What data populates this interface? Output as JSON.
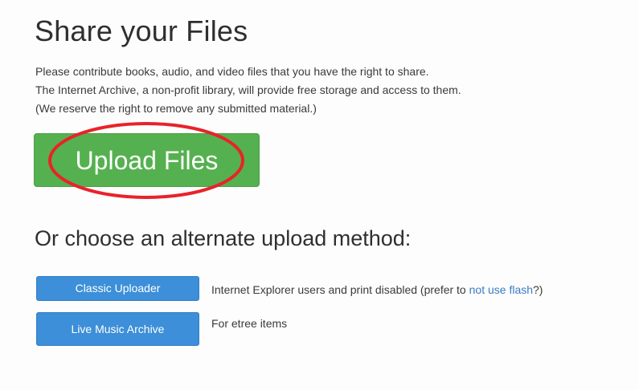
{
  "page": {
    "title": "Share your Files",
    "intro": [
      "Please contribute books, audio, and video files that you have the right to share.",
      "The Internet Archive, a non-profit library, will provide free storage and access to them.",
      "(We reserve the right to remove any submitted material.)"
    ],
    "upload_label": "Upload Files",
    "alternate_heading": "Or choose an alternate upload method:"
  },
  "alternate_methods": {
    "classic": {
      "label": "Classic Uploader",
      "desc_before": "Internet Explorer users and print disabled (prefer to ",
      "link_text": "not use flash",
      "desc_after": "?)"
    },
    "live_music": {
      "label": "Live Music Archive",
      "desc": "For etree items"
    }
  },
  "colors": {
    "upload_button": "#55b14f",
    "alt_button": "#3c8fd8",
    "highlight_ring": "#e8232a",
    "link": "#3a7bc4"
  }
}
